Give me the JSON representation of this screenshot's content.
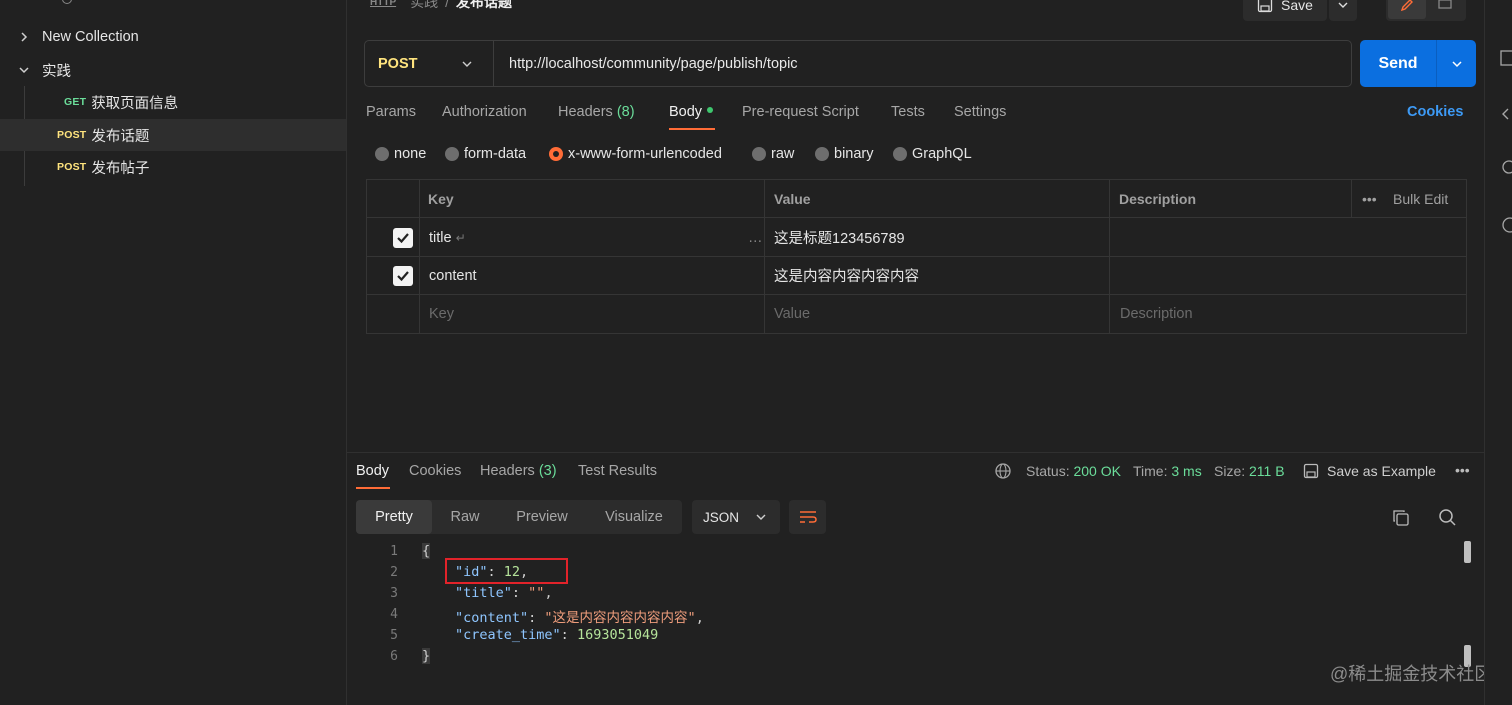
{
  "sidebar": {
    "collection_label": "New Collection",
    "folder_label": "实践",
    "requests": [
      {
        "method": "GET",
        "name": "获取页面信息"
      },
      {
        "method": "POST",
        "name": "发布话题"
      },
      {
        "method": "POST",
        "name": "发布帖子"
      }
    ]
  },
  "header": {
    "breadcrumb_parent": "实践",
    "breadcrumb_sep": "/",
    "breadcrumb_current": "发布话题",
    "save_label": "Save"
  },
  "request": {
    "method": "POST",
    "url": "http://localhost/community/page/publish/topic",
    "send_label": "Send",
    "tabs": {
      "params": "Params",
      "authorization": "Authorization",
      "headers": "Headers",
      "headers_count": "(8)",
      "body": "Body",
      "pre_request": "Pre-request Script",
      "tests": "Tests",
      "settings": "Settings"
    },
    "cookies_label": "Cookies",
    "body_modes": [
      "none",
      "form-data",
      "x-www-form-urlencoded",
      "raw",
      "binary",
      "GraphQL"
    ],
    "body_mode_selected": "x-www-form-urlencoded",
    "table": {
      "headers": {
        "key": "Key",
        "value": "Value",
        "description": "Description",
        "bulk_edit": "Bulk Edit"
      },
      "rows": [
        {
          "checked": true,
          "key": "title",
          "value": "这是标题123456789",
          "description": ""
        },
        {
          "checked": true,
          "key": "content",
          "value": "这是内容内容内容内容",
          "description": ""
        }
      ],
      "placeholders": {
        "key": "Key",
        "value": "Value",
        "description": "Description"
      }
    }
  },
  "response": {
    "tabs": {
      "body": "Body",
      "cookies": "Cookies",
      "headers": "Headers",
      "headers_count": "(3)",
      "test_results": "Test Results"
    },
    "status_label": "Status:",
    "status_value": "200 OK",
    "time_label": "Time:",
    "time_value": "3 ms",
    "size_label": "Size:",
    "size_value": "211 B",
    "save_example_label": "Save as Example",
    "view_modes": [
      "Pretty",
      "Raw",
      "Preview",
      "Visualize"
    ],
    "view_mode_selected": "Pretty",
    "format": "JSON",
    "line_numbers": [
      "1",
      "2",
      "3",
      "4",
      "5",
      "6"
    ],
    "json": {
      "open_brace": "{",
      "close_brace": "}",
      "id_key": "\"id\"",
      "id_val": "12",
      "title_key": "\"title\"",
      "title_val": "\"\"",
      "content_key": "\"content\"",
      "content_val": "\"这是内容内容内容内容\"",
      "create_time_key": "\"create_time\"",
      "create_time_val": "1693051049"
    }
  },
  "watermark": "@稀土掘金技术社区",
  "colors": {
    "accent": "#ff6c37",
    "send": "#0b6fe0",
    "post": "#ffe47e",
    "get": "#6bdd9a",
    "highlight_box": "#e2232a"
  }
}
